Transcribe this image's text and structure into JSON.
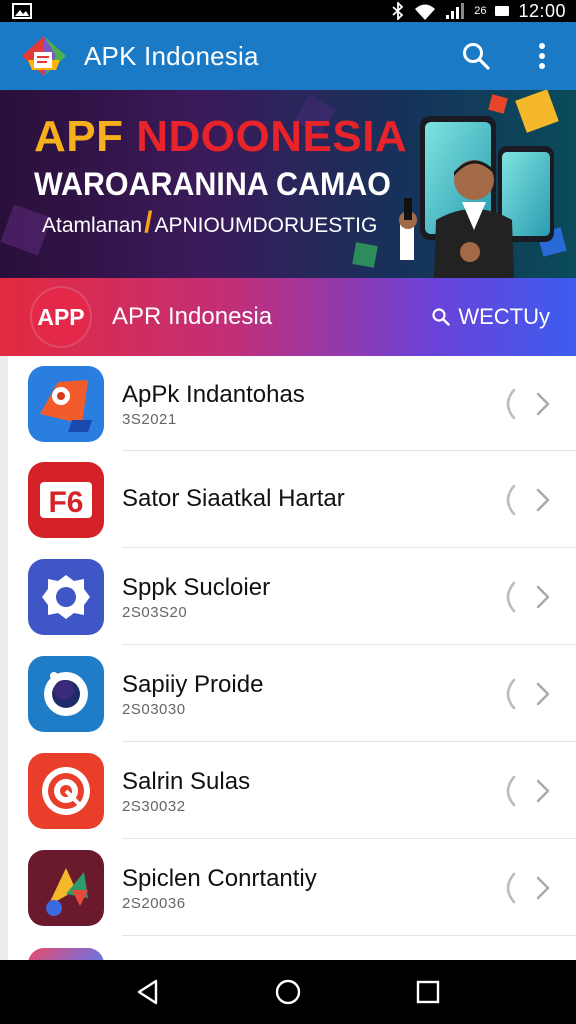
{
  "status_bar": {
    "time": "12:00",
    "network_label": "26"
  },
  "app_bar": {
    "title": "APK Indonesia",
    "icons": [
      "search-icon",
      "more-vert-icon"
    ]
  },
  "banner": {
    "title_part1": "APF ",
    "title_part2": "NDOONESIA",
    "subtitle": "WAROARANINA CAMAO",
    "tagline_left": "Atamlaпan",
    "tagline_right": "APNIOUMDORUESTIG"
  },
  "header": {
    "badge": "APP",
    "title": "APR Indonesia",
    "search_label": "WECTUy"
  },
  "apps": [
    {
      "name": "ApPk Indantohas",
      "sub": "3S2021",
      "icon_color": "#2a7ee0"
    },
    {
      "name": "Sator Siaatkal Hartar",
      "sub": "",
      "icon_color": "#d42228"
    },
    {
      "name": "Sppk Sucloier",
      "sub": "2S03S20",
      "icon_color": "#3f56c6"
    },
    {
      "name": "Sapiiy Proide",
      "sub": "2S03030",
      "icon_color": "#1f7cc6"
    },
    {
      "name": "Salrin Sulas",
      "sub": "2S30032",
      "icon_color": "#e93f2a"
    },
    {
      "name": "Spiclen Conrtantiy",
      "sub": "2S20036",
      "icon_color": "#6a1a2c"
    },
    {
      "name": "",
      "sub": "",
      "icon_color": "#7a6fd8"
    }
  ],
  "colors": {
    "app_bar": "#1a7ac6",
    "accent_red": "#e32a40",
    "accent_blue": "#3d5cf0"
  }
}
